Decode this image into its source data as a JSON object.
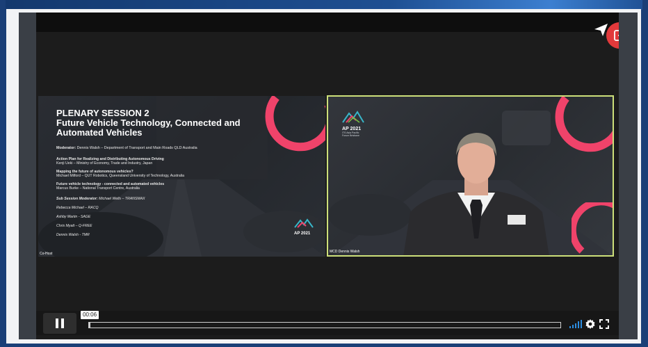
{
  "slide": {
    "title_line1": "PLENARY SESSION 2",
    "title_line2": "Future Vehicle Technology, Connected and",
    "title_line3": "Automated Vehicles",
    "moderator_label": "Moderator:",
    "moderator_text": "Dennis Walsh – Department of Transport and Main Roads QLD Australia",
    "items": [
      {
        "title": "Action Plan for Realizing and Distributing Autonomous Driving",
        "speaker": "Kenji Ueki – Ministry of Economy, Trade and Industry, Japan"
      },
      {
        "title": "Mapping the future of autonomous vehicles?",
        "speaker": "Michael Milford – QUT Robotics, Queensland University of Technology, Australia"
      },
      {
        "title": "Future vehicle technology - connected and automated vehicles",
        "speaker": "Marcus Burke – National Transport Centre, Australia"
      }
    ],
    "sub_moderator_label": "Sub Session Moderator:",
    "sub_moderator_text": "Michael Wells – TRANSMAX",
    "panelists": [
      "Rebecca Michael – RACQ",
      "Ashby Martin - SAGE",
      "Chris Myatt – Q-FREE",
      "Dennis Walsh - TMR"
    ],
    "logo_text": "AP 2021",
    "speaker_label": "Co-Host"
  },
  "video": {
    "logo_text": "AP 2021",
    "logo_sub1": "ITS Asia Pacific",
    "logo_sub2": "Forum Brisbane",
    "name_label": "MCD Dennis Walsh"
  },
  "controls": {
    "time": "00:06",
    "progress": 0.003
  },
  "colors": {
    "accent_pink": "#f0436a",
    "exit_red": "#e1393b",
    "frame_green": "#cde07a",
    "signal_blue": "#2c8de0"
  }
}
